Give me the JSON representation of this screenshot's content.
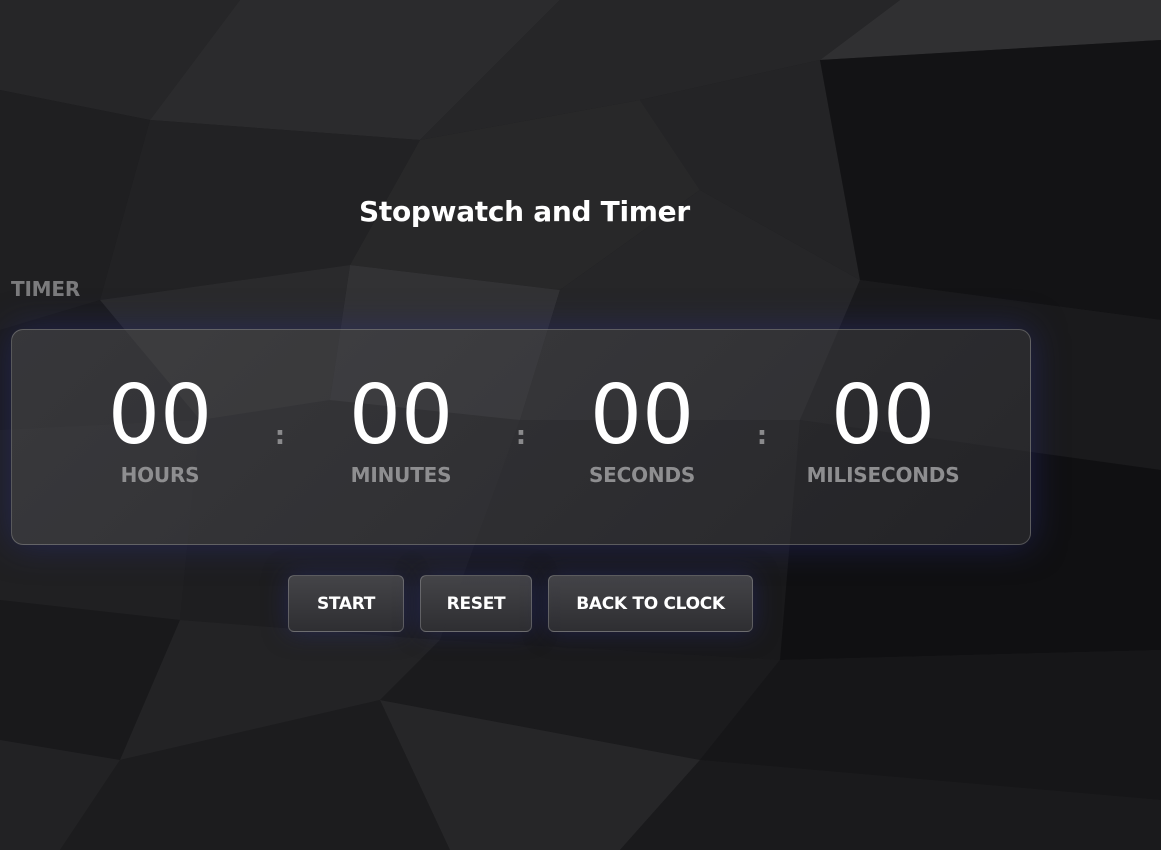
{
  "page": {
    "title": "Stopwatch and Timer"
  },
  "timer": {
    "section_label": "TIMER",
    "hours": {
      "value": "00",
      "label": "HOURS"
    },
    "minutes": {
      "value": "00",
      "label": "MINUTES"
    },
    "seconds": {
      "value": "00",
      "label": "SECONDS"
    },
    "milliseconds": {
      "value": "00",
      "label": "MILISECONDS"
    },
    "separator": ":"
  },
  "controls": {
    "start_label": "START",
    "reset_label": "RESET",
    "back_label": "BACK TO CLOCK"
  },
  "colors": {
    "background": "#1c1c1e",
    "text": "#ffffff",
    "muted_label": "#8e8e90",
    "glow": "#282c78"
  }
}
